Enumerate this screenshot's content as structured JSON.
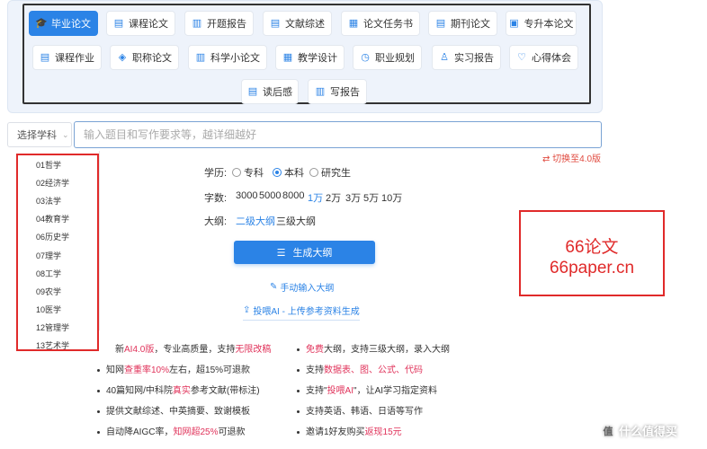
{
  "paper_tabs": [
    {
      "label": "毕业论文",
      "icon": "graduation-cap-icon",
      "glyph": "🎓",
      "active": true
    },
    {
      "label": "课程论文",
      "icon": "book-icon",
      "glyph": "▤"
    },
    {
      "label": "开题报告",
      "icon": "report-icon",
      "glyph": "▥"
    },
    {
      "label": "文献综述",
      "icon": "document-icon",
      "glyph": "▤"
    },
    {
      "label": "论文任务书",
      "icon": "task-book-icon",
      "glyph": "▦"
    },
    {
      "label": "期刊论文",
      "icon": "journal-icon",
      "glyph": "▤"
    },
    {
      "label": "专升本论文",
      "icon": "upgrade-icon",
      "glyph": "▣"
    },
    {
      "label": "课程作业",
      "icon": "homework-icon",
      "glyph": "▤"
    },
    {
      "label": "职称论文",
      "icon": "badge-icon",
      "glyph": "◈"
    },
    {
      "label": "科学小论文",
      "icon": "science-icon",
      "glyph": "▥"
    },
    {
      "label": "教学设计",
      "icon": "teaching-icon",
      "glyph": "▦"
    },
    {
      "label": "职业规划",
      "icon": "clock-icon",
      "glyph": "◷"
    },
    {
      "label": "实习报告",
      "icon": "user-icon",
      "glyph": "♙"
    },
    {
      "label": "心得体会",
      "icon": "heart-icon",
      "glyph": "♡"
    },
    {
      "label": "读后感",
      "icon": "reading-icon",
      "glyph": "▤"
    },
    {
      "label": "写报告",
      "icon": "write-icon",
      "glyph": "▥"
    }
  ],
  "subject_select": {
    "label": "选择学科",
    "chevron": "⌄"
  },
  "topic_input": {
    "placeholder": "输入题目和写作要求等，越详细越好",
    "value": ""
  },
  "switch_version": "⇄ 切换至4.0版",
  "subjects": [
    "01哲学",
    "02经济学",
    "03法学",
    "04教育学",
    "06历史学",
    "07理学",
    "08工学",
    "09农学",
    "10医学",
    "12管理学",
    "13艺术学"
  ],
  "education": {
    "label": "学历:",
    "options": [
      {
        "label": "专科",
        "selected": false
      },
      {
        "label": "本科",
        "selected": true
      },
      {
        "label": "研究生",
        "selected": false
      }
    ]
  },
  "word_count": {
    "label": "字数:",
    "options": [
      "3000",
      "5000",
      "8000",
      "1万",
      "2万",
      "3万",
      "5万",
      "10万"
    ],
    "selected": "1万"
  },
  "outline": {
    "label": "大纲:",
    "options": [
      "二级大纲",
      "三级大纲"
    ],
    "selected": "二级大纲"
  },
  "generate_button": {
    "label": "生成大纲",
    "icon": "list-icon",
    "glyph": "☰"
  },
  "manual_outline_link": {
    "label": "手动输入大纲",
    "icon": "edit-icon",
    "glyph": "✎"
  },
  "upload_reference_link": {
    "label": "投喂AI - 上传参考资料生成",
    "icon": "upload-icon",
    "glyph": "⇪"
  },
  "brand": {
    "line1": "66论文",
    "line2": "66paper.cn"
  },
  "features_left": [
    [
      {
        "t": "新"
      },
      {
        "t": "AI4.0版",
        "red": true
      },
      {
        "t": "，专业高质量，支持"
      },
      {
        "t": "无限改稿",
        "red": true
      }
    ],
    [
      {
        "t": "知网"
      },
      {
        "t": "查重率10%",
        "red": true
      },
      {
        "t": "左右，超15%可退款"
      }
    ],
    [
      {
        "t": "40篇知网/中科院"
      },
      {
        "t": "真实",
        "red": true
      },
      {
        "t": "参考文献(带标注)"
      }
    ],
    [
      {
        "t": "提供文献综述、中英摘要、致谢模板"
      }
    ],
    [
      {
        "t": "自动降AIGC率，"
      },
      {
        "t": "知网超25%",
        "red": true
      },
      {
        "t": "可退款"
      }
    ]
  ],
  "features_right": [
    [
      {
        "t": "免费",
        "red": true
      },
      {
        "t": "大纲，支持三级大纲，录入大纲"
      }
    ],
    [
      {
        "t": "支持"
      },
      {
        "t": "数据表、图、公式、代码",
        "red": true
      }
    ],
    [
      {
        "t": "支持\""
      },
      {
        "t": "投喂AI",
        "red": true
      },
      {
        "t": "\"，让AI学习指定资料"
      }
    ],
    [
      {
        "t": "支持英语、韩语、日语等写作"
      }
    ],
    [
      {
        "t": "邀请1好友购买"
      },
      {
        "t": "返现15元",
        "red": true
      }
    ]
  ],
  "watermark": {
    "text": "什么值得买",
    "icon": "值"
  },
  "colors": {
    "accent": "#2b83e6",
    "highlight_red": "#e0325a",
    "annotation_red": "#e02a2a"
  }
}
